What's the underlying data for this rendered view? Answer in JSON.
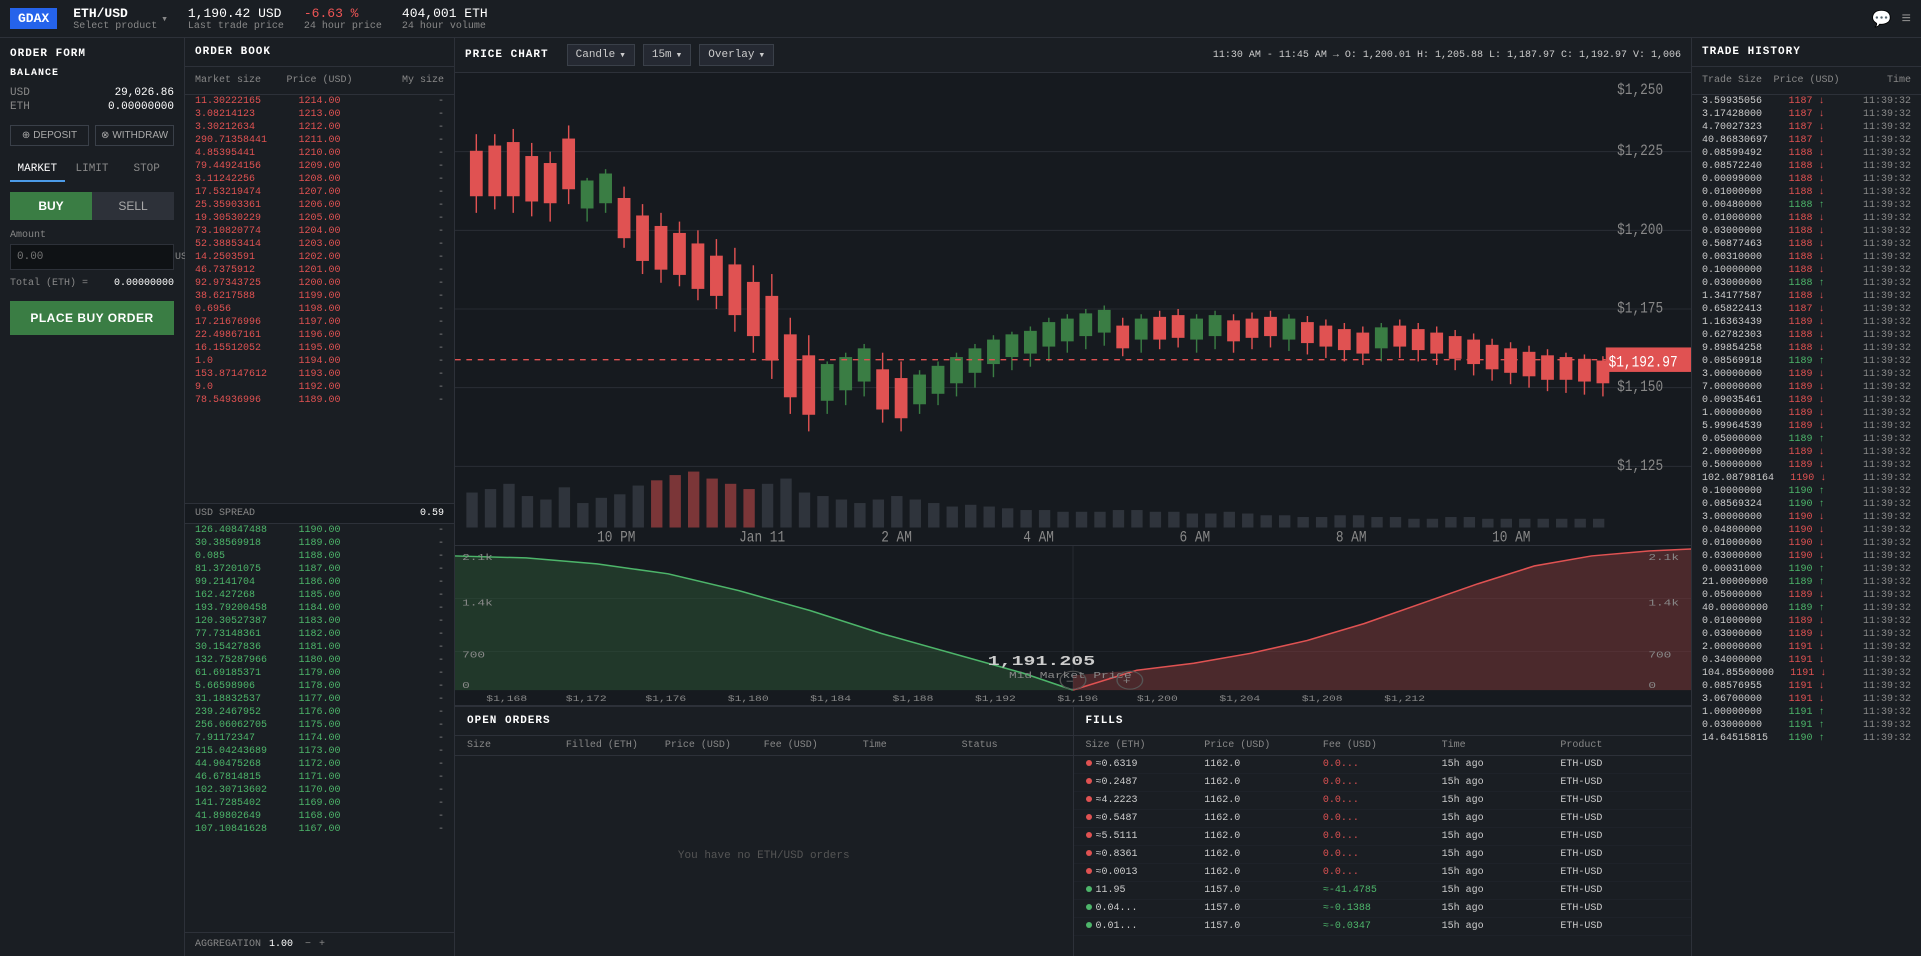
{
  "header": {
    "logo": "GDAX",
    "pair": "ETH/USD",
    "pair_sub": "Select product",
    "last_price": "1,190.42 USD",
    "last_price_label": "Last trade price",
    "change": "-6.63 %",
    "change_label": "24 hour price",
    "volume": "404,001 ETH",
    "volume_label": "24 hour volume",
    "chat_icon": "💬",
    "menu_icon": "≡"
  },
  "order_form": {
    "title": "ORDER FORM",
    "balance_title": "BALANCE",
    "usd_label": "USD",
    "usd_value": "29,026.86",
    "eth_label": "ETH",
    "eth_value": "0.00000000",
    "deposit_label": "DEPOSIT",
    "withdraw_label": "WITHDRAW",
    "tabs": [
      "MARKET",
      "LIMIT",
      "STOP"
    ],
    "active_tab": "MARKET",
    "buy_label": "BUY",
    "sell_label": "SELL",
    "amount_label": "Amount",
    "amount_placeholder": "0.00",
    "amount_unit": "USD",
    "total_label": "Total (ETH) =",
    "total_value": "0.00000000",
    "place_order_label": "PLACE BUY ORDER"
  },
  "order_book": {
    "title": "ORDER BOOK",
    "col_market_size": "Market size",
    "col_price": "Price (USD)",
    "col_my_size": "My size",
    "asks": [
      {
        "size": "11.30222165",
        "price": "1214.00"
      },
      {
        "size": "3.08214123",
        "price": "1213.00"
      },
      {
        "size": "3.30212634",
        "price": "1212.00"
      },
      {
        "size": "290.71358441",
        "price": "1211.00"
      },
      {
        "size": "4.85395441",
        "price": "1210.00"
      },
      {
        "size": "79.44924156",
        "price": "1209.00"
      },
      {
        "size": "3.11242256",
        "price": "1208.00"
      },
      {
        "size": "17.53219474",
        "price": "1207.00"
      },
      {
        "size": "25.35903361",
        "price": "1206.00"
      },
      {
        "size": "19.30530229",
        "price": "1205.00"
      },
      {
        "size": "73.10820774",
        "price": "1204.00"
      },
      {
        "size": "52.38853414",
        "price": "1203.00"
      },
      {
        "size": "14.2503591",
        "price": "1202.00"
      },
      {
        "size": "46.7375912",
        "price": "1201.00"
      },
      {
        "size": "92.97343725",
        "price": "1200.00"
      },
      {
        "size": "38.6217588",
        "price": "1199.00"
      },
      {
        "size": "0.6956",
        "price": "1198.00"
      },
      {
        "size": "17.21676996",
        "price": "1197.00"
      },
      {
        "size": "22.49867161",
        "price": "1196.00"
      },
      {
        "size": "16.15512052",
        "price": "1195.00"
      },
      {
        "size": "1.0",
        "price": "1194.00"
      },
      {
        "size": "153.87147612",
        "price": "1193.00"
      },
      {
        "size": "9.0",
        "price": "1192.00"
      },
      {
        "size": "78.54936996",
        "price": "1189.00"
      }
    ],
    "spread_label": "USD SPREAD",
    "spread_value": "0.59",
    "bids": [
      {
        "size": "126.40847488",
        "price": "1190.00"
      },
      {
        "size": "30.38569918",
        "price": "1189.00"
      },
      {
        "size": "0.085",
        "price": "1188.00"
      },
      {
        "size": "81.37201075",
        "price": "1187.00"
      },
      {
        "size": "99.2141704",
        "price": "1186.00"
      },
      {
        "size": "162.427268",
        "price": "1185.00"
      },
      {
        "size": "193.79200458",
        "price": "1184.00"
      },
      {
        "size": "120.30527387",
        "price": "1183.00"
      },
      {
        "size": "77.73148361",
        "price": "1182.00"
      },
      {
        "size": "30.15427836",
        "price": "1181.00"
      },
      {
        "size": "132.75287966",
        "price": "1180.00"
      },
      {
        "size": "61.69185371",
        "price": "1179.00"
      },
      {
        "size": "5.66598906",
        "price": "1178.00"
      },
      {
        "size": "31.18832537",
        "price": "1177.00"
      },
      {
        "size": "239.2467952",
        "price": "1176.00"
      },
      {
        "size": "256.06062705",
        "price": "1175.00"
      },
      {
        "size": "7.91172347",
        "price": "1174.00"
      },
      {
        "size": "215.04243689",
        "price": "1173.00"
      },
      {
        "size": "44.90475268",
        "price": "1172.00"
      },
      {
        "size": "46.67814815",
        "price": "1171.00"
      },
      {
        "size": "102.30713602",
        "price": "1170.00"
      },
      {
        "size": "141.7285402",
        "price": "1169.00"
      },
      {
        "size": "41.89802649",
        "price": "1168.00"
      },
      {
        "size": "107.10841628",
        "price": "1167.00"
      }
    ],
    "aggregation_label": "AGGREGATION",
    "aggregation_value": "1.00"
  },
  "price_chart": {
    "title": "PRICE CHART",
    "chart_type": "Candle",
    "time_frame": "15m",
    "overlay": "Overlay",
    "info_time": "11:30 AM - 11:45 AM →",
    "info_o": "O: 1,200.01",
    "info_h": "H: 1,205.88",
    "info_l": "L: 1,187.97",
    "info_c": "C: 1,192.97",
    "info_v": "V: 1,006",
    "y_labels": [
      "$1,250",
      "$1,225",
      "$1,200",
      "$1,175",
      "$1,150",
      "$1,125"
    ],
    "x_labels": [
      "10 PM",
      "Jan 11",
      "2 AM",
      "4 AM",
      "6 AM",
      "8 AM",
      "10 AM"
    ],
    "current_price": "$1,192.97",
    "mid_market_price": "1,191.205",
    "mid_market_label": "Mid Market Price",
    "zoom_minus": "−",
    "zoom_plus": "+"
  },
  "depth_chart": {
    "y_left_top": "2.1k",
    "y_left_bottom": "0",
    "y_right_top": "2.1k",
    "y_right_bottom": "0",
    "y_mid": "1.4k",
    "y_mid_right": "1.4k",
    "y_700": "700",
    "y_700_right": "700",
    "x_labels": [
      "$1,168",
      "$1,172",
      "$1,176",
      "$1,180",
      "$1,184",
      "$1,188",
      "$1,192",
      "$1,196",
      "$1,200",
      "$1,204",
      "$1,208",
      "$1,212"
    ]
  },
  "open_orders": {
    "title": "OPEN ORDERS",
    "cols": [
      "Size",
      "Filled (ETH)",
      "Price (USD)",
      "Fee (USD)",
      "Time",
      "Status"
    ],
    "empty_message": "You have no ETH/USD orders"
  },
  "fills": {
    "title": "FILLS",
    "cols": [
      "Size (ETH)",
      "Price (USD)",
      "Fee (USD)",
      "Time",
      "Product"
    ],
    "rows": [
      {
        "size": "≈0.6319",
        "price": "1162.0",
        "fee": "0.0...",
        "time": "15h ago",
        "product": "ETH-USD",
        "side": "sell"
      },
      {
        "size": "≈0.2487",
        "price": "1162.0",
        "fee": "0.0...",
        "time": "15h ago",
        "product": "ETH-USD",
        "side": "sell"
      },
      {
        "size": "≈4.2223",
        "price": "1162.0",
        "fee": "0.0...",
        "time": "15h ago",
        "product": "ETH-USD",
        "side": "sell"
      },
      {
        "size": "≈0.5487",
        "price": "1162.0",
        "fee": "0.0...",
        "time": "15h ago",
        "product": "ETH-USD",
        "side": "sell"
      },
      {
        "size": "≈5.5111",
        "price": "1162.0",
        "fee": "0.0...",
        "time": "15h ago",
        "product": "ETH-USD",
        "side": "sell"
      },
      {
        "size": "≈0.8361",
        "price": "1162.0",
        "fee": "0.0...",
        "time": "15h ago",
        "product": "ETH-USD",
        "side": "sell"
      },
      {
        "size": "≈0.0013",
        "price": "1162.0",
        "fee": "0.0...",
        "time": "15h ago",
        "product": "ETH-USD",
        "side": "sell"
      },
      {
        "size": "11.95",
        "price": "1157.0",
        "fee": "≈-41.4785",
        "time": "15h ago",
        "product": "ETH-USD",
        "side": "buy"
      },
      {
        "size": "0.04...",
        "price": "1157.0",
        "fee": "≈-0.1388",
        "time": "15h ago",
        "product": "ETH-USD",
        "side": "buy"
      },
      {
        "size": "0.01...",
        "price": "1157.0",
        "fee": "≈-0.0347",
        "time": "15h ago",
        "product": "ETH-USD",
        "side": "buy"
      }
    ]
  },
  "trade_history": {
    "title": "TRADE HISTORY",
    "col_size": "Trade Size",
    "col_price": "Price (USD)",
    "col_time": "Time",
    "rows": [
      {
        "size": "3.59935056",
        "price": "1187",
        "dir": "down",
        "time": "11:39:32"
      },
      {
        "size": "3.17428000",
        "price": "1187",
        "dir": "down",
        "time": "11:39:32"
      },
      {
        "size": "4.70027323",
        "price": "1187",
        "dir": "down",
        "time": "11:39:32"
      },
      {
        "size": "40.86830697",
        "price": "1187",
        "dir": "down",
        "time": "11:39:32"
      },
      {
        "size": "0.08599492",
        "price": "1188",
        "dir": "down",
        "time": "11:39:32"
      },
      {
        "size": "0.08572240",
        "price": "1188",
        "dir": "down",
        "time": "11:39:32"
      },
      {
        "size": "0.00099000",
        "price": "1188",
        "dir": "down",
        "time": "11:39:32"
      },
      {
        "size": "0.01000000",
        "price": "1188",
        "dir": "down",
        "time": "11:39:32"
      },
      {
        "size": "0.00480000",
        "price": "1188",
        "dir": "up",
        "time": "11:39:32"
      },
      {
        "size": "0.01000000",
        "price": "1188",
        "dir": "down",
        "time": "11:39:32"
      },
      {
        "size": "0.03000000",
        "price": "1188",
        "dir": "down",
        "time": "11:39:32"
      },
      {
        "size": "0.50877463",
        "price": "1188",
        "dir": "down",
        "time": "11:39:32"
      },
      {
        "size": "0.00310000",
        "price": "1188",
        "dir": "down",
        "time": "11:39:32"
      },
      {
        "size": "0.10000000",
        "price": "1188",
        "dir": "down",
        "time": "11:39:32"
      },
      {
        "size": "0.03000000",
        "price": "1188",
        "dir": "up",
        "time": "11:39:32"
      },
      {
        "size": "1.34177587",
        "price": "1188",
        "dir": "down",
        "time": "11:39:32"
      },
      {
        "size": "0.65822413",
        "price": "1187",
        "dir": "down",
        "time": "11:39:32"
      },
      {
        "size": "1.16363439",
        "price": "1189",
        "dir": "down",
        "time": "11:39:32"
      },
      {
        "size": "0.62782303",
        "price": "1188",
        "dir": "down",
        "time": "11:39:32"
      },
      {
        "size": "9.89854258",
        "price": "1188",
        "dir": "down",
        "time": "11:39:32"
      },
      {
        "size": "0.08569918",
        "price": "1189",
        "dir": "up",
        "time": "11:39:32"
      },
      {
        "size": "3.00000000",
        "price": "1189",
        "dir": "down",
        "time": "11:39:32"
      },
      {
        "size": "7.00000000",
        "price": "1189",
        "dir": "down",
        "time": "11:39:32"
      },
      {
        "size": "0.09035461",
        "price": "1189",
        "dir": "down",
        "time": "11:39:32"
      },
      {
        "size": "1.00000000",
        "price": "1189",
        "dir": "down",
        "time": "11:39:32"
      },
      {
        "size": "5.99964539",
        "price": "1189",
        "dir": "down",
        "time": "11:39:32"
      },
      {
        "size": "0.05000000",
        "price": "1189",
        "dir": "up",
        "time": "11:39:32"
      },
      {
        "size": "2.00000000",
        "price": "1189",
        "dir": "down",
        "time": "11:39:32"
      },
      {
        "size": "0.50000000",
        "price": "1189",
        "dir": "down",
        "time": "11:39:32"
      },
      {
        "size": "102.08798164",
        "price": "1190",
        "dir": "down",
        "time": "11:39:32"
      },
      {
        "size": "0.10000000",
        "price": "1190",
        "dir": "up",
        "time": "11:39:32"
      },
      {
        "size": "0.08569324",
        "price": "1190",
        "dir": "up",
        "time": "11:39:32"
      },
      {
        "size": "3.00000000",
        "price": "1190",
        "dir": "down",
        "time": "11:39:32"
      },
      {
        "size": "0.04800000",
        "price": "1190",
        "dir": "down",
        "time": "11:39:32"
      },
      {
        "size": "0.01000000",
        "price": "1190",
        "dir": "down",
        "time": "11:39:32"
      },
      {
        "size": "0.03000000",
        "price": "1190",
        "dir": "down",
        "time": "11:39:32"
      },
      {
        "size": "0.00031000",
        "price": "1190",
        "dir": "up",
        "time": "11:39:32"
      },
      {
        "size": "21.00000000",
        "price": "1189",
        "dir": "up",
        "time": "11:39:32"
      },
      {
        "size": "0.05000000",
        "price": "1189",
        "dir": "down",
        "time": "11:39:32"
      },
      {
        "size": "40.00000000",
        "price": "1189",
        "dir": "up",
        "time": "11:39:32"
      },
      {
        "size": "0.01000000",
        "price": "1189",
        "dir": "down",
        "time": "11:39:32"
      },
      {
        "size": "0.03000000",
        "price": "1189",
        "dir": "down",
        "time": "11:39:32"
      },
      {
        "size": "2.00000000",
        "price": "1191",
        "dir": "down",
        "time": "11:39:32"
      },
      {
        "size": "0.34000000",
        "price": "1191",
        "dir": "down",
        "time": "11:39:32"
      },
      {
        "size": "104.85500000",
        "price": "1191",
        "dir": "down",
        "time": "11:39:32"
      },
      {
        "size": "0.08576955",
        "price": "1191",
        "dir": "down",
        "time": "11:39:32"
      },
      {
        "size": "3.06700000",
        "price": "1191",
        "dir": "down",
        "time": "11:39:32"
      },
      {
        "size": "1.00000000",
        "price": "1191",
        "dir": "up",
        "time": "11:39:32"
      },
      {
        "size": "0.03000000",
        "price": "1191",
        "dir": "up",
        "time": "11:39:32"
      },
      {
        "size": "14.64515815",
        "price": "1190",
        "dir": "up",
        "time": "11:39:32"
      }
    ]
  }
}
